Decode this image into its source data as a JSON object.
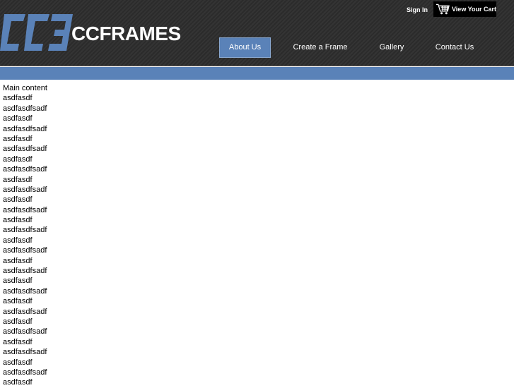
{
  "header": {
    "logo_text": "CCFRAMES",
    "sign_in_label": "Sign In",
    "cart_label": "View Your Cart"
  },
  "nav": {
    "items": [
      {
        "label": "About Us",
        "active": true
      },
      {
        "label": "Create a Frame",
        "active": false
      },
      {
        "label": "Gallery",
        "active": false
      },
      {
        "label": "Contact Us",
        "active": false
      }
    ]
  },
  "colors": {
    "header_bg": "#2b2b2b",
    "accent_blue": "#5a82b8",
    "logo_blue": "#5a82b8",
    "text": "#000000"
  },
  "icons": {
    "cart": "shopping-cart-icon",
    "logo": "ccframes-logo-mark"
  },
  "main": {
    "title": "Main content",
    "lines": [
      "asdfasdf",
      "asdfasdfsadf",
      "asdfasdf",
      "asdfasdfsadf",
      "asdfasdf",
      "asdfasdfsadf",
      "asdfasdf",
      "asdfasdfsadf",
      "asdfasdf",
      "asdfasdfsadf",
      "asdfasdf",
      "asdfasdfsadf",
      "asdfasdf",
      "asdfasdfsadf",
      "asdfasdf",
      "asdfasdfsadf",
      "asdfasdf",
      "asdfasdfsadf",
      "asdfasdf",
      "asdfasdfsadf",
      "asdfasdf",
      "asdfasdfsadf",
      "asdfasdf",
      "asdfasdfsadf",
      "asdfasdf",
      "asdfasdfsadf",
      "asdfasdf",
      "asdfasdfsadf",
      "asdfasdf"
    ]
  }
}
